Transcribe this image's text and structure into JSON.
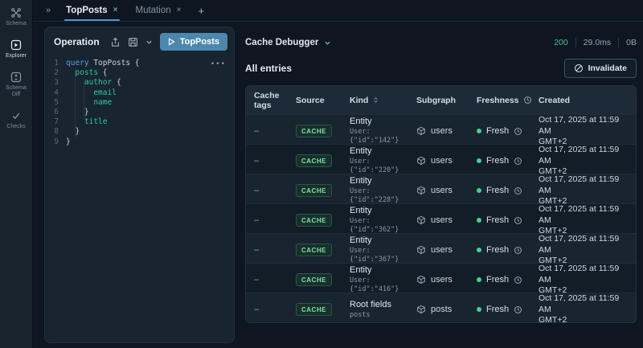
{
  "colors": {
    "accent_blue": "#4d97c9",
    "run_button_blue": "#4c87ad",
    "field_green": "#2ec9a2",
    "keyword_blue": "#5aa0d8",
    "badge_green": "#7ee2ae",
    "fresh_dot_green": "#43d08f",
    "status_green": "#58c08b"
  },
  "rail": {
    "items": [
      {
        "label": "Schema"
      },
      {
        "label": "Explorer",
        "active": true
      },
      {
        "label": "Schema Diff"
      },
      {
        "label": "Checks"
      }
    ]
  },
  "tabbar": {
    "collapse": "»",
    "tabs": [
      {
        "label": "TopPosts",
        "close": "×",
        "active": true
      },
      {
        "label": "Mutation",
        "close": "×",
        "active": false
      }
    ],
    "add": "+"
  },
  "operation": {
    "title": "Operation",
    "run_label": "TopPosts",
    "menu_ellipsis": "•••",
    "code": [
      {
        "num": "1",
        "segments": [
          {
            "text": "query ",
            "type": "keyword"
          },
          {
            "text": "TopPosts {",
            "type": "plain"
          }
        ]
      },
      {
        "num": "2",
        "segments": [
          {
            "text": "  ",
            "type": "plain"
          },
          {
            "text": "posts",
            "type": "field"
          },
          {
            "text": " {",
            "type": "plain"
          }
        ]
      },
      {
        "num": "3",
        "segments": [
          {
            "text": "    ",
            "type": "plain"
          },
          {
            "text": "author",
            "type": "field"
          },
          {
            "text": " {",
            "type": "plain"
          }
        ]
      },
      {
        "num": "4",
        "segments": [
          {
            "text": "      ",
            "type": "plain"
          },
          {
            "text": "email",
            "type": "field"
          }
        ]
      },
      {
        "num": "5",
        "segments": [
          {
            "text": "      ",
            "type": "plain"
          },
          {
            "text": "name",
            "type": "field"
          }
        ]
      },
      {
        "num": "6",
        "segments": [
          {
            "text": "    }",
            "type": "plain"
          }
        ]
      },
      {
        "num": "7",
        "segments": [
          {
            "text": "    ",
            "type": "plain"
          },
          {
            "text": "title",
            "type": "field"
          }
        ]
      },
      {
        "num": "8",
        "segments": [
          {
            "text": "  }",
            "type": "plain"
          }
        ]
      },
      {
        "num": "9",
        "segments": [
          {
            "text": "}",
            "type": "plain"
          }
        ]
      }
    ]
  },
  "cache_debugger": {
    "title": "Cache Debugger",
    "stats": {
      "status": "200",
      "duration": "29.0ms",
      "size": "0B"
    },
    "entries_heading": "All entries",
    "invalidate_label": "Invalidate",
    "table": {
      "columns": [
        "Cache tags",
        "Source",
        "Kind",
        "Subgraph",
        "Freshness",
        "Created"
      ],
      "rows": [
        {
          "cache_tags": "–",
          "source": "CACHE",
          "kind": "Entity",
          "kind_detail": "User:{\"id\":\"142\"}",
          "subgraph": "users",
          "freshness": "Fresh",
          "created_line1": "Oct 17, 2025 at 11:59 AM",
          "created_line2": "GMT+2"
        },
        {
          "cache_tags": "–",
          "source": "CACHE",
          "kind": "Entity",
          "kind_detail": "User:{\"id\":\"220\"}",
          "subgraph": "users",
          "freshness": "Fresh",
          "created_line1": "Oct 17, 2025 at 11:59 AM",
          "created_line2": "GMT+2"
        },
        {
          "cache_tags": "–",
          "source": "CACHE",
          "kind": "Entity",
          "kind_detail": "User:{\"id\":\"228\"}",
          "subgraph": "users",
          "freshness": "Fresh",
          "created_line1": "Oct 17, 2025 at 11:59 AM",
          "created_line2": "GMT+2"
        },
        {
          "cache_tags": "–",
          "source": "CACHE",
          "kind": "Entity",
          "kind_detail": "User:{\"id\":\"362\"}",
          "subgraph": "users",
          "freshness": "Fresh",
          "created_line1": "Oct 17, 2025 at 11:59 AM",
          "created_line2": "GMT+2"
        },
        {
          "cache_tags": "–",
          "source": "CACHE",
          "kind": "Entity",
          "kind_detail": "User:{\"id\":\"367\"}",
          "subgraph": "users",
          "freshness": "Fresh",
          "created_line1": "Oct 17, 2025 at 11:59 AM",
          "created_line2": "GMT+2"
        },
        {
          "cache_tags": "–",
          "source": "CACHE",
          "kind": "Entity",
          "kind_detail": "User:{\"id\":\"416\"}",
          "subgraph": "users",
          "freshness": "Fresh",
          "created_line1": "Oct 17, 2025 at 11:59 AM",
          "created_line2": "GMT+2"
        },
        {
          "cache_tags": "–",
          "source": "CACHE",
          "kind": "Root fields",
          "kind_detail": "posts",
          "subgraph": "posts",
          "freshness": "Fresh",
          "created_line1": "Oct 17, 2025 at 11:59 AM",
          "created_line2": "GMT+2"
        }
      ]
    }
  }
}
